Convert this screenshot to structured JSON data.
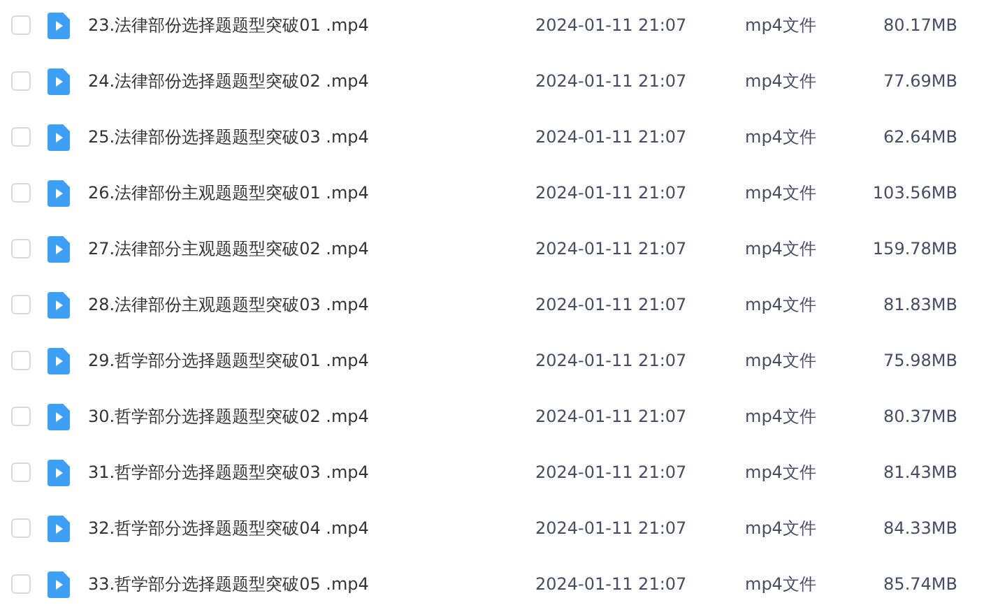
{
  "files": [
    {
      "name": "23.法律部份选择题题型突破01 .mp4",
      "date": "2024-01-11 21:07",
      "type": "mp4文件",
      "size": "80.17MB",
      "selected": false
    },
    {
      "name": "24.法律部份选择题题型突破02 .mp4",
      "date": "2024-01-11 21:07",
      "type": "mp4文件",
      "size": "77.69MB",
      "selected": false
    },
    {
      "name": "25.法律部份选择题题型突破03 .mp4",
      "date": "2024-01-11 21:07",
      "type": "mp4文件",
      "size": "62.64MB",
      "selected": false
    },
    {
      "name": "26.法律部份主观题题型突破01 .mp4",
      "date": "2024-01-11 21:07",
      "type": "mp4文件",
      "size": "103.56MB",
      "selected": false
    },
    {
      "name": "27.法律部分主观题题型突破02 .mp4",
      "date": "2024-01-11 21:07",
      "type": "mp4文件",
      "size": "159.78MB",
      "selected": false
    },
    {
      "name": "28.法律部份主观题题型突破03 .mp4",
      "date": "2024-01-11 21:07",
      "type": "mp4文件",
      "size": "81.83MB",
      "selected": false
    },
    {
      "name": "29.哲学部分选择题题型突破01 .mp4",
      "date": "2024-01-11 21:07",
      "type": "mp4文件",
      "size": "75.98MB",
      "selected": false
    },
    {
      "name": "30.哲学部分选择题题型突破02 .mp4",
      "date": "2024-01-11 21:07",
      "type": "mp4文件",
      "size": "80.37MB",
      "selected": false
    },
    {
      "name": "31.哲学部分选择题题型突破03 .mp4",
      "date": "2024-01-11 21:07",
      "type": "mp4文件",
      "size": "81.43MB",
      "selected": false
    },
    {
      "name": "32.哲学部分选择题题型突破04 .mp4",
      "date": "2024-01-11 21:07",
      "type": "mp4文件",
      "size": "84.33MB",
      "selected": false
    },
    {
      "name": "33.哲学部分选择题题型突破05 .mp4",
      "date": "2024-01-11 21:07",
      "type": "mp4文件",
      "size": "85.74MB",
      "selected": false
    }
  ]
}
